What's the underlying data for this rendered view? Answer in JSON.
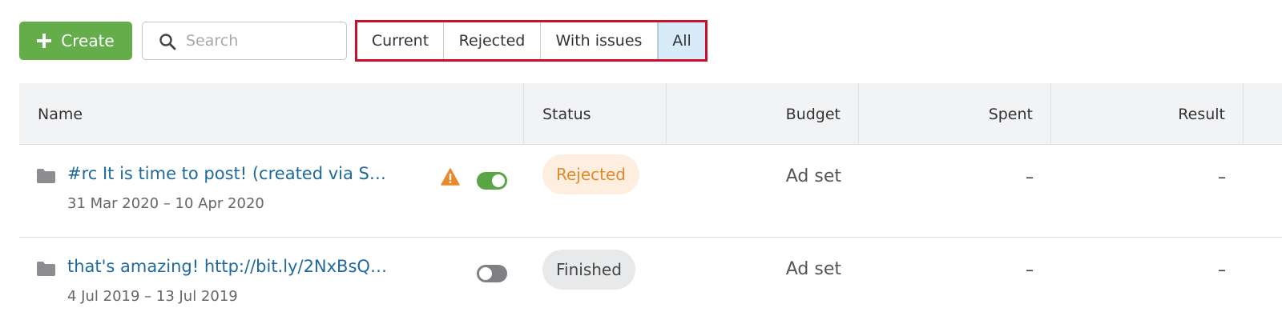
{
  "toolbar": {
    "create_label": "Create",
    "search_placeholder": "Search",
    "search_value": "",
    "filters": [
      {
        "label": "Current",
        "active": false
      },
      {
        "label": "Rejected",
        "active": false
      },
      {
        "label": "With issues",
        "active": false
      },
      {
        "label": "All",
        "active": true
      }
    ]
  },
  "table": {
    "columns": [
      "Name",
      "Status",
      "Budget",
      "Spent",
      "Result"
    ],
    "rows": [
      {
        "name": "#rc It is time to post! (created via S…",
        "dates": "31 Mar 2020 – 10 Apr 2020",
        "has_warning": true,
        "toggle_on": true,
        "status": "Rejected",
        "budget": "Ad set",
        "spent": "–",
        "result": "–"
      },
      {
        "name": "that's amazing! http://bit.ly/2NxBsQ…",
        "dates": "4 Jul 2019 – 13 Jul 2019",
        "has_warning": false,
        "toggle_on": false,
        "status": "Finished",
        "budget": "Ad set",
        "spent": "–",
        "result": "–"
      }
    ]
  },
  "colors": {
    "create_button": "#65ac4a",
    "filter_highlight_border": "#c8102e",
    "active_filter_bg": "#d8ebf9",
    "link": "#1f6a9a",
    "rejected_badge_bg": "#fdeee0",
    "rejected_badge_text": "#e08a2a",
    "finished_badge_bg": "#e8e9eb",
    "warning": "#e8892c",
    "toggle_on": "#5aa646",
    "toggle_off": "#7e8083"
  },
  "icons": [
    "plus-icon",
    "search-icon",
    "folder-icon",
    "warning-icon"
  ]
}
